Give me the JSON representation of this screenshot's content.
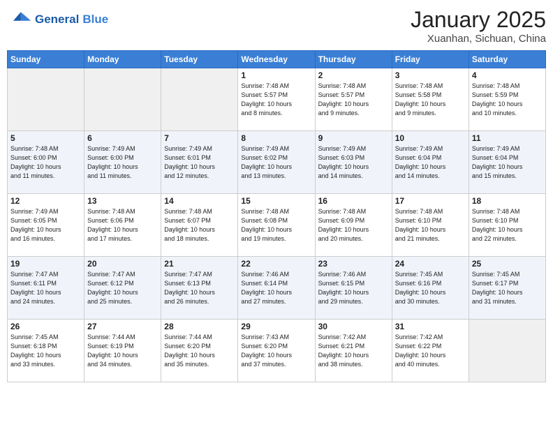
{
  "header": {
    "logo_general": "General",
    "logo_blue": "Blue",
    "month_year": "January 2025",
    "location": "Xuanhan, Sichuan, China"
  },
  "days_of_week": [
    "Sunday",
    "Monday",
    "Tuesday",
    "Wednesday",
    "Thursday",
    "Friday",
    "Saturday"
  ],
  "weeks": [
    [
      {
        "day": "",
        "info": ""
      },
      {
        "day": "",
        "info": ""
      },
      {
        "day": "",
        "info": ""
      },
      {
        "day": "1",
        "info": "Sunrise: 7:48 AM\nSunset: 5:57 PM\nDaylight: 10 hours\nand 8 minutes."
      },
      {
        "day": "2",
        "info": "Sunrise: 7:48 AM\nSunset: 5:57 PM\nDaylight: 10 hours\nand 9 minutes."
      },
      {
        "day": "3",
        "info": "Sunrise: 7:48 AM\nSunset: 5:58 PM\nDaylight: 10 hours\nand 9 minutes."
      },
      {
        "day": "4",
        "info": "Sunrise: 7:48 AM\nSunset: 5:59 PM\nDaylight: 10 hours\nand 10 minutes."
      }
    ],
    [
      {
        "day": "5",
        "info": "Sunrise: 7:48 AM\nSunset: 6:00 PM\nDaylight: 10 hours\nand 11 minutes."
      },
      {
        "day": "6",
        "info": "Sunrise: 7:49 AM\nSunset: 6:00 PM\nDaylight: 10 hours\nand 11 minutes."
      },
      {
        "day": "7",
        "info": "Sunrise: 7:49 AM\nSunset: 6:01 PM\nDaylight: 10 hours\nand 12 minutes."
      },
      {
        "day": "8",
        "info": "Sunrise: 7:49 AM\nSunset: 6:02 PM\nDaylight: 10 hours\nand 13 minutes."
      },
      {
        "day": "9",
        "info": "Sunrise: 7:49 AM\nSunset: 6:03 PM\nDaylight: 10 hours\nand 14 minutes."
      },
      {
        "day": "10",
        "info": "Sunrise: 7:49 AM\nSunset: 6:04 PM\nDaylight: 10 hours\nand 14 minutes."
      },
      {
        "day": "11",
        "info": "Sunrise: 7:49 AM\nSunset: 6:04 PM\nDaylight: 10 hours\nand 15 minutes."
      }
    ],
    [
      {
        "day": "12",
        "info": "Sunrise: 7:49 AM\nSunset: 6:05 PM\nDaylight: 10 hours\nand 16 minutes."
      },
      {
        "day": "13",
        "info": "Sunrise: 7:48 AM\nSunset: 6:06 PM\nDaylight: 10 hours\nand 17 minutes."
      },
      {
        "day": "14",
        "info": "Sunrise: 7:48 AM\nSunset: 6:07 PM\nDaylight: 10 hours\nand 18 minutes."
      },
      {
        "day": "15",
        "info": "Sunrise: 7:48 AM\nSunset: 6:08 PM\nDaylight: 10 hours\nand 19 minutes."
      },
      {
        "day": "16",
        "info": "Sunrise: 7:48 AM\nSunset: 6:09 PM\nDaylight: 10 hours\nand 20 minutes."
      },
      {
        "day": "17",
        "info": "Sunrise: 7:48 AM\nSunset: 6:10 PM\nDaylight: 10 hours\nand 21 minutes."
      },
      {
        "day": "18",
        "info": "Sunrise: 7:48 AM\nSunset: 6:10 PM\nDaylight: 10 hours\nand 22 minutes."
      }
    ],
    [
      {
        "day": "19",
        "info": "Sunrise: 7:47 AM\nSunset: 6:11 PM\nDaylight: 10 hours\nand 24 minutes."
      },
      {
        "day": "20",
        "info": "Sunrise: 7:47 AM\nSunset: 6:12 PM\nDaylight: 10 hours\nand 25 minutes."
      },
      {
        "day": "21",
        "info": "Sunrise: 7:47 AM\nSunset: 6:13 PM\nDaylight: 10 hours\nand 26 minutes."
      },
      {
        "day": "22",
        "info": "Sunrise: 7:46 AM\nSunset: 6:14 PM\nDaylight: 10 hours\nand 27 minutes."
      },
      {
        "day": "23",
        "info": "Sunrise: 7:46 AM\nSunset: 6:15 PM\nDaylight: 10 hours\nand 29 minutes."
      },
      {
        "day": "24",
        "info": "Sunrise: 7:45 AM\nSunset: 6:16 PM\nDaylight: 10 hours\nand 30 minutes."
      },
      {
        "day": "25",
        "info": "Sunrise: 7:45 AM\nSunset: 6:17 PM\nDaylight: 10 hours\nand 31 minutes."
      }
    ],
    [
      {
        "day": "26",
        "info": "Sunrise: 7:45 AM\nSunset: 6:18 PM\nDaylight: 10 hours\nand 33 minutes."
      },
      {
        "day": "27",
        "info": "Sunrise: 7:44 AM\nSunset: 6:19 PM\nDaylight: 10 hours\nand 34 minutes."
      },
      {
        "day": "28",
        "info": "Sunrise: 7:44 AM\nSunset: 6:20 PM\nDaylight: 10 hours\nand 35 minutes."
      },
      {
        "day": "29",
        "info": "Sunrise: 7:43 AM\nSunset: 6:20 PM\nDaylight: 10 hours\nand 37 minutes."
      },
      {
        "day": "30",
        "info": "Sunrise: 7:42 AM\nSunset: 6:21 PM\nDaylight: 10 hours\nand 38 minutes."
      },
      {
        "day": "31",
        "info": "Sunrise: 7:42 AM\nSunset: 6:22 PM\nDaylight: 10 hours\nand 40 minutes."
      },
      {
        "day": "",
        "info": ""
      }
    ]
  ]
}
